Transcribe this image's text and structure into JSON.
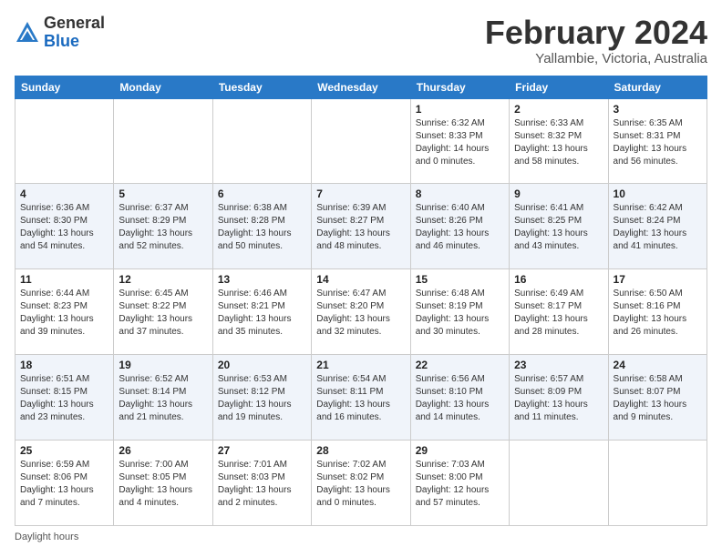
{
  "logo": {
    "general": "General",
    "blue": "Blue"
  },
  "header": {
    "month": "February 2024",
    "location": "Yallambie, Victoria, Australia"
  },
  "days_of_week": [
    "Sunday",
    "Monday",
    "Tuesday",
    "Wednesday",
    "Thursday",
    "Friday",
    "Saturday"
  ],
  "weeks": [
    [
      {
        "day": "",
        "detail": ""
      },
      {
        "day": "",
        "detail": ""
      },
      {
        "day": "",
        "detail": ""
      },
      {
        "day": "",
        "detail": ""
      },
      {
        "day": "1",
        "detail": "Sunrise: 6:32 AM\nSunset: 8:33 PM\nDaylight: 14 hours\nand 0 minutes."
      },
      {
        "day": "2",
        "detail": "Sunrise: 6:33 AM\nSunset: 8:32 PM\nDaylight: 13 hours\nand 58 minutes."
      },
      {
        "day": "3",
        "detail": "Sunrise: 6:35 AM\nSunset: 8:31 PM\nDaylight: 13 hours\nand 56 minutes."
      }
    ],
    [
      {
        "day": "4",
        "detail": "Sunrise: 6:36 AM\nSunset: 8:30 PM\nDaylight: 13 hours\nand 54 minutes."
      },
      {
        "day": "5",
        "detail": "Sunrise: 6:37 AM\nSunset: 8:29 PM\nDaylight: 13 hours\nand 52 minutes."
      },
      {
        "day": "6",
        "detail": "Sunrise: 6:38 AM\nSunset: 8:28 PM\nDaylight: 13 hours\nand 50 minutes."
      },
      {
        "day": "7",
        "detail": "Sunrise: 6:39 AM\nSunset: 8:27 PM\nDaylight: 13 hours\nand 48 minutes."
      },
      {
        "day": "8",
        "detail": "Sunrise: 6:40 AM\nSunset: 8:26 PM\nDaylight: 13 hours\nand 46 minutes."
      },
      {
        "day": "9",
        "detail": "Sunrise: 6:41 AM\nSunset: 8:25 PM\nDaylight: 13 hours\nand 43 minutes."
      },
      {
        "day": "10",
        "detail": "Sunrise: 6:42 AM\nSunset: 8:24 PM\nDaylight: 13 hours\nand 41 minutes."
      }
    ],
    [
      {
        "day": "11",
        "detail": "Sunrise: 6:44 AM\nSunset: 8:23 PM\nDaylight: 13 hours\nand 39 minutes."
      },
      {
        "day": "12",
        "detail": "Sunrise: 6:45 AM\nSunset: 8:22 PM\nDaylight: 13 hours\nand 37 minutes."
      },
      {
        "day": "13",
        "detail": "Sunrise: 6:46 AM\nSunset: 8:21 PM\nDaylight: 13 hours\nand 35 minutes."
      },
      {
        "day": "14",
        "detail": "Sunrise: 6:47 AM\nSunset: 8:20 PM\nDaylight: 13 hours\nand 32 minutes."
      },
      {
        "day": "15",
        "detail": "Sunrise: 6:48 AM\nSunset: 8:19 PM\nDaylight: 13 hours\nand 30 minutes."
      },
      {
        "day": "16",
        "detail": "Sunrise: 6:49 AM\nSunset: 8:17 PM\nDaylight: 13 hours\nand 28 minutes."
      },
      {
        "day": "17",
        "detail": "Sunrise: 6:50 AM\nSunset: 8:16 PM\nDaylight: 13 hours\nand 26 minutes."
      }
    ],
    [
      {
        "day": "18",
        "detail": "Sunrise: 6:51 AM\nSunset: 8:15 PM\nDaylight: 13 hours\nand 23 minutes."
      },
      {
        "day": "19",
        "detail": "Sunrise: 6:52 AM\nSunset: 8:14 PM\nDaylight: 13 hours\nand 21 minutes."
      },
      {
        "day": "20",
        "detail": "Sunrise: 6:53 AM\nSunset: 8:12 PM\nDaylight: 13 hours\nand 19 minutes."
      },
      {
        "day": "21",
        "detail": "Sunrise: 6:54 AM\nSunset: 8:11 PM\nDaylight: 13 hours\nand 16 minutes."
      },
      {
        "day": "22",
        "detail": "Sunrise: 6:56 AM\nSunset: 8:10 PM\nDaylight: 13 hours\nand 14 minutes."
      },
      {
        "day": "23",
        "detail": "Sunrise: 6:57 AM\nSunset: 8:09 PM\nDaylight: 13 hours\nand 11 minutes."
      },
      {
        "day": "24",
        "detail": "Sunrise: 6:58 AM\nSunset: 8:07 PM\nDaylight: 13 hours\nand 9 minutes."
      }
    ],
    [
      {
        "day": "25",
        "detail": "Sunrise: 6:59 AM\nSunset: 8:06 PM\nDaylight: 13 hours\nand 7 minutes."
      },
      {
        "day": "26",
        "detail": "Sunrise: 7:00 AM\nSunset: 8:05 PM\nDaylight: 13 hours\nand 4 minutes."
      },
      {
        "day": "27",
        "detail": "Sunrise: 7:01 AM\nSunset: 8:03 PM\nDaylight: 13 hours\nand 2 minutes."
      },
      {
        "day": "28",
        "detail": "Sunrise: 7:02 AM\nSunset: 8:02 PM\nDaylight: 13 hours\nand 0 minutes."
      },
      {
        "day": "29",
        "detail": "Sunrise: 7:03 AM\nSunset: 8:00 PM\nDaylight: 12 hours\nand 57 minutes."
      },
      {
        "day": "",
        "detail": ""
      },
      {
        "day": "",
        "detail": ""
      }
    ]
  ],
  "footer": {
    "daylight_label": "Daylight hours"
  }
}
